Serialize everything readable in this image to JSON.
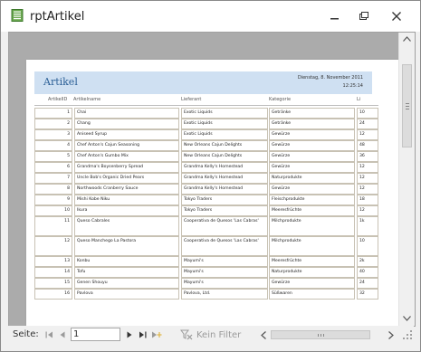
{
  "window": {
    "title": "rptArtikel"
  },
  "report": {
    "title": "Artikel",
    "date": "Dienstag, 8. November 2011",
    "time": "12:25:14",
    "columns": [
      "ArtikelID",
      "Artikelname",
      "Lieferant",
      "Kategorie",
      "Li"
    ],
    "rows": [
      {
        "id": "1",
        "name": "Chai",
        "supplier": "Exotic Liquids",
        "category": "Getränke",
        "extra": "10"
      },
      {
        "id": "2",
        "name": "Chang",
        "supplier": "Exotic Liquids",
        "category": "Getränke",
        "extra": "24"
      },
      {
        "id": "3",
        "name": "Aniseed Syrup",
        "supplier": "Exotic Liquids",
        "category": "Gewürze",
        "extra": "12"
      },
      {
        "id": "4",
        "name": "Chef Anton's Cajun Seasoning",
        "supplier": "New Orleans Cajun Delights",
        "category": "Gewürze",
        "extra": "48"
      },
      {
        "id": "5",
        "name": "Chef Anton's Gumbo Mix",
        "supplier": "New Orleans Cajun Delights",
        "category": "Gewürze",
        "extra": "36"
      },
      {
        "id": "6",
        "name": "Grandma's Boysenberry Spread",
        "supplier": "Grandma Kelly's Homestead",
        "category": "Gewürze",
        "extra": "12"
      },
      {
        "id": "7",
        "name": "Uncle Bob's Organic Dried Pears",
        "supplier": "Grandma Kelly's Homestead",
        "category": "Naturprodukte",
        "extra": "12"
      },
      {
        "id": "8",
        "name": "Northwoods Cranberry Sauce",
        "supplier": "Grandma Kelly's Homestead",
        "category": "Gewürze",
        "extra": "12"
      },
      {
        "id": "9",
        "name": "Mishi Kobe Niku",
        "supplier": "Tokyo Traders",
        "category": "Fleischprodukte",
        "extra": "18"
      },
      {
        "id": "10",
        "name": "Ikura",
        "supplier": "Tokyo Traders",
        "category": "Meeresfrüchte",
        "extra": "12"
      },
      {
        "id": "11",
        "name": "Queso Cabrales",
        "supplier": "Cooperativa de Quesos 'Las Cabras'",
        "category": "Milchprodukte",
        "extra": "1k"
      },
      {
        "id": "12",
        "name": "Queso Manchego La Pastora",
        "supplier": "Cooperativa de Quesos 'Las Cabras'",
        "category": "Milchprodukte",
        "extra": "10"
      },
      {
        "id": "13",
        "name": "Konbu",
        "supplier": "Mayumi's",
        "category": "Meeresfrüchte",
        "extra": "2k"
      },
      {
        "id": "14",
        "name": "Tofu",
        "supplier": "Mayumi's",
        "category": "Naturprodukte",
        "extra": "40"
      },
      {
        "id": "15",
        "name": "Genen Shouyu",
        "supplier": "Mayumi's",
        "category": "Gewürze",
        "extra": "24"
      },
      {
        "id": "16",
        "name": "Pavlova",
        "supplier": "Pavlova, Ltd.",
        "category": "Süßwaren",
        "extra": "32"
      }
    ]
  },
  "nav": {
    "label": "Seite:",
    "page": "1",
    "filter_label": "Kein Filter"
  }
}
